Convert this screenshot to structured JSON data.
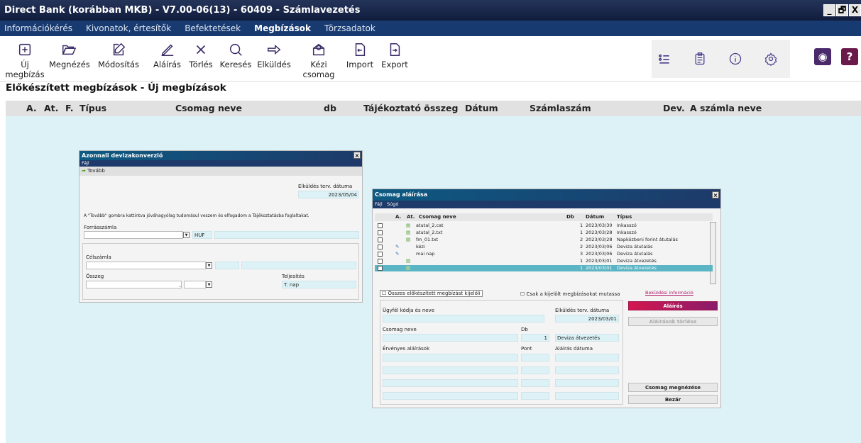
{
  "window": {
    "title": "Direct Bank (korábban MKB) - V7.00-06(13) - 60409 - Számlavezetés",
    "btn_min": "_",
    "btn_max": "🗗",
    "btn_close": "X"
  },
  "menu": [
    {
      "label": "Információkérés"
    },
    {
      "label": "Kivonatok, értesítők"
    },
    {
      "label": "Befektetések"
    },
    {
      "label": "Megbízások"
    },
    {
      "label": "Törzsadatok"
    }
  ],
  "toolbar": {
    "new": "Új megbízás",
    "view": "Megnézés",
    "modify": "Módosítás",
    "sign": "Aláírás",
    "delete": "Törlés",
    "search": "Keresés",
    "send": "Elküldés",
    "manual": "Kézi csomag",
    "import": "Import",
    "export": "Export"
  },
  "page_title": "Előkészített megbízások - Új megbízások",
  "grid_headers": [
    "A.",
    "At.",
    "F.",
    "Típus",
    "Csomag neve",
    "db",
    "Tájékoztató összeg",
    "Dátum",
    "Számlaszám",
    "Dev.",
    "A számla neve"
  ],
  "conv": {
    "title": "Azonnali devizakonverzió",
    "menu": "Fájl",
    "next": "Tovább",
    "send_date_label": "Elküldés terv. dátuma",
    "send_date": "2023/05/04",
    "notice": "A \"Tovább\" gombra kattintva jóváhagyólag tudomásul veszem és elfogadom a Tájékoztatásba foglaltakat.",
    "source_label": "Forrásszámla",
    "currency": "HUF",
    "target_label": "Célszámla",
    "amount_label": "Összeg",
    "exec_label": "Teljesítés",
    "exec_value": "T. nap"
  },
  "sign": {
    "title": "Csomag aláírása",
    "menu_file": "Fájl",
    "menu_help": "Súgó",
    "headers": {
      "a": "A.",
      "at": "At.",
      "name": "Csomag neve",
      "db": "Db",
      "date": "Dátum",
      "type": "Típus"
    },
    "rows": [
      {
        "name": "atutal_2.cat",
        "db": "1",
        "date": "2023/03/30",
        "type": "Inkasszó"
      },
      {
        "name": "atutal_2.txt",
        "db": "1",
        "date": "2023/03/28",
        "type": "Inkasszó"
      },
      {
        "name": "fm_01.txt",
        "db": "2",
        "date": "2023/03/28",
        "type": "Napközbeni forint átutalás"
      },
      {
        "name": "kézi",
        "db": "2",
        "date": "2023/03/06",
        "type": "Deviza átutalás"
      },
      {
        "name": "mai nap",
        "db": "3",
        "date": "2023/03/06",
        "type": "Deviza átutalás"
      },
      {
        "name": "",
        "db": "1",
        "date": "2023/03/01",
        "type": "Deviza átvezetés"
      },
      {
        "name": "",
        "db": "1",
        "date": "2023/03/01",
        "type": "Deviza átvezetés"
      }
    ],
    "select_all": "Összes előkészített megbízást kijelöli",
    "show_selected": "Csak a kijelölt megbízásokat mutassa",
    "send_info": "Beküldési információ",
    "client_label": "Ügyfél kódja és neve",
    "send_date_label": "Elküldés terv. dátuma",
    "send_date": "2023/03/01",
    "pkg_label": "Csomag neve",
    "db_label": "Db",
    "db_value": "1",
    "pkg_type": "Deviza átvezetés",
    "sigs_label": "Érvényes aláírások",
    "point_label": "Pont",
    "sigdate_label": "Aláírás dátuma",
    "btn_sign": "Aláírás",
    "btn_clear": "Aláírások törlése",
    "btn_view": "Csomag megnézése",
    "btn_close": "Bezár"
  },
  "colors": {
    "titlebar": "#1a2a4e",
    "menubar": "#173a70",
    "grid_bg": "#dcf2f6",
    "accent": "#c0104e",
    "selected_row": "#5bb5c4"
  }
}
